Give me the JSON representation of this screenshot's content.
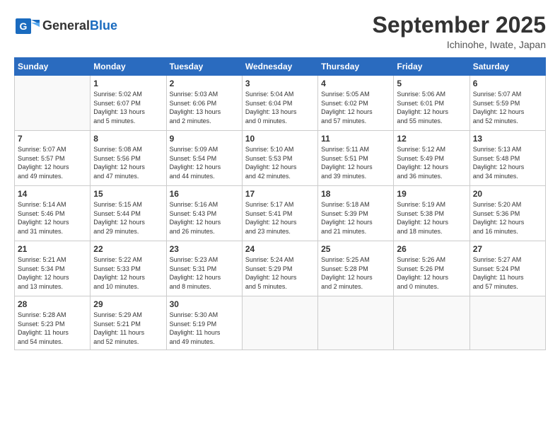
{
  "header": {
    "logo_general": "General",
    "logo_blue": "Blue",
    "month": "September 2025",
    "location": "Ichinohe, Iwate, Japan"
  },
  "weekdays": [
    "Sunday",
    "Monday",
    "Tuesday",
    "Wednesday",
    "Thursday",
    "Friday",
    "Saturday"
  ],
  "weeks": [
    [
      {
        "day": "",
        "info": ""
      },
      {
        "day": "1",
        "info": "Sunrise: 5:02 AM\nSunset: 6:07 PM\nDaylight: 13 hours\nand 5 minutes."
      },
      {
        "day": "2",
        "info": "Sunrise: 5:03 AM\nSunset: 6:06 PM\nDaylight: 13 hours\nand 2 minutes."
      },
      {
        "day": "3",
        "info": "Sunrise: 5:04 AM\nSunset: 6:04 PM\nDaylight: 13 hours\nand 0 minutes."
      },
      {
        "day": "4",
        "info": "Sunrise: 5:05 AM\nSunset: 6:02 PM\nDaylight: 12 hours\nand 57 minutes."
      },
      {
        "day": "5",
        "info": "Sunrise: 5:06 AM\nSunset: 6:01 PM\nDaylight: 12 hours\nand 55 minutes."
      },
      {
        "day": "6",
        "info": "Sunrise: 5:07 AM\nSunset: 5:59 PM\nDaylight: 12 hours\nand 52 minutes."
      }
    ],
    [
      {
        "day": "7",
        "info": "Sunrise: 5:07 AM\nSunset: 5:57 PM\nDaylight: 12 hours\nand 49 minutes."
      },
      {
        "day": "8",
        "info": "Sunrise: 5:08 AM\nSunset: 5:56 PM\nDaylight: 12 hours\nand 47 minutes."
      },
      {
        "day": "9",
        "info": "Sunrise: 5:09 AM\nSunset: 5:54 PM\nDaylight: 12 hours\nand 44 minutes."
      },
      {
        "day": "10",
        "info": "Sunrise: 5:10 AM\nSunset: 5:53 PM\nDaylight: 12 hours\nand 42 minutes."
      },
      {
        "day": "11",
        "info": "Sunrise: 5:11 AM\nSunset: 5:51 PM\nDaylight: 12 hours\nand 39 minutes."
      },
      {
        "day": "12",
        "info": "Sunrise: 5:12 AM\nSunset: 5:49 PM\nDaylight: 12 hours\nand 36 minutes."
      },
      {
        "day": "13",
        "info": "Sunrise: 5:13 AM\nSunset: 5:48 PM\nDaylight: 12 hours\nand 34 minutes."
      }
    ],
    [
      {
        "day": "14",
        "info": "Sunrise: 5:14 AM\nSunset: 5:46 PM\nDaylight: 12 hours\nand 31 minutes."
      },
      {
        "day": "15",
        "info": "Sunrise: 5:15 AM\nSunset: 5:44 PM\nDaylight: 12 hours\nand 29 minutes."
      },
      {
        "day": "16",
        "info": "Sunrise: 5:16 AM\nSunset: 5:43 PM\nDaylight: 12 hours\nand 26 minutes."
      },
      {
        "day": "17",
        "info": "Sunrise: 5:17 AM\nSunset: 5:41 PM\nDaylight: 12 hours\nand 23 minutes."
      },
      {
        "day": "18",
        "info": "Sunrise: 5:18 AM\nSunset: 5:39 PM\nDaylight: 12 hours\nand 21 minutes."
      },
      {
        "day": "19",
        "info": "Sunrise: 5:19 AM\nSunset: 5:38 PM\nDaylight: 12 hours\nand 18 minutes."
      },
      {
        "day": "20",
        "info": "Sunrise: 5:20 AM\nSunset: 5:36 PM\nDaylight: 12 hours\nand 16 minutes."
      }
    ],
    [
      {
        "day": "21",
        "info": "Sunrise: 5:21 AM\nSunset: 5:34 PM\nDaylight: 12 hours\nand 13 minutes."
      },
      {
        "day": "22",
        "info": "Sunrise: 5:22 AM\nSunset: 5:33 PM\nDaylight: 12 hours\nand 10 minutes."
      },
      {
        "day": "23",
        "info": "Sunrise: 5:23 AM\nSunset: 5:31 PM\nDaylight: 12 hours\nand 8 minutes."
      },
      {
        "day": "24",
        "info": "Sunrise: 5:24 AM\nSunset: 5:29 PM\nDaylight: 12 hours\nand 5 minutes."
      },
      {
        "day": "25",
        "info": "Sunrise: 5:25 AM\nSunset: 5:28 PM\nDaylight: 12 hours\nand 2 minutes."
      },
      {
        "day": "26",
        "info": "Sunrise: 5:26 AM\nSunset: 5:26 PM\nDaylight: 12 hours\nand 0 minutes."
      },
      {
        "day": "27",
        "info": "Sunrise: 5:27 AM\nSunset: 5:24 PM\nDaylight: 11 hours\nand 57 minutes."
      }
    ],
    [
      {
        "day": "28",
        "info": "Sunrise: 5:28 AM\nSunset: 5:23 PM\nDaylight: 11 hours\nand 54 minutes."
      },
      {
        "day": "29",
        "info": "Sunrise: 5:29 AM\nSunset: 5:21 PM\nDaylight: 11 hours\nand 52 minutes."
      },
      {
        "day": "30",
        "info": "Sunrise: 5:30 AM\nSunset: 5:19 PM\nDaylight: 11 hours\nand 49 minutes."
      },
      {
        "day": "",
        "info": ""
      },
      {
        "day": "",
        "info": ""
      },
      {
        "day": "",
        "info": ""
      },
      {
        "day": "",
        "info": ""
      }
    ]
  ]
}
